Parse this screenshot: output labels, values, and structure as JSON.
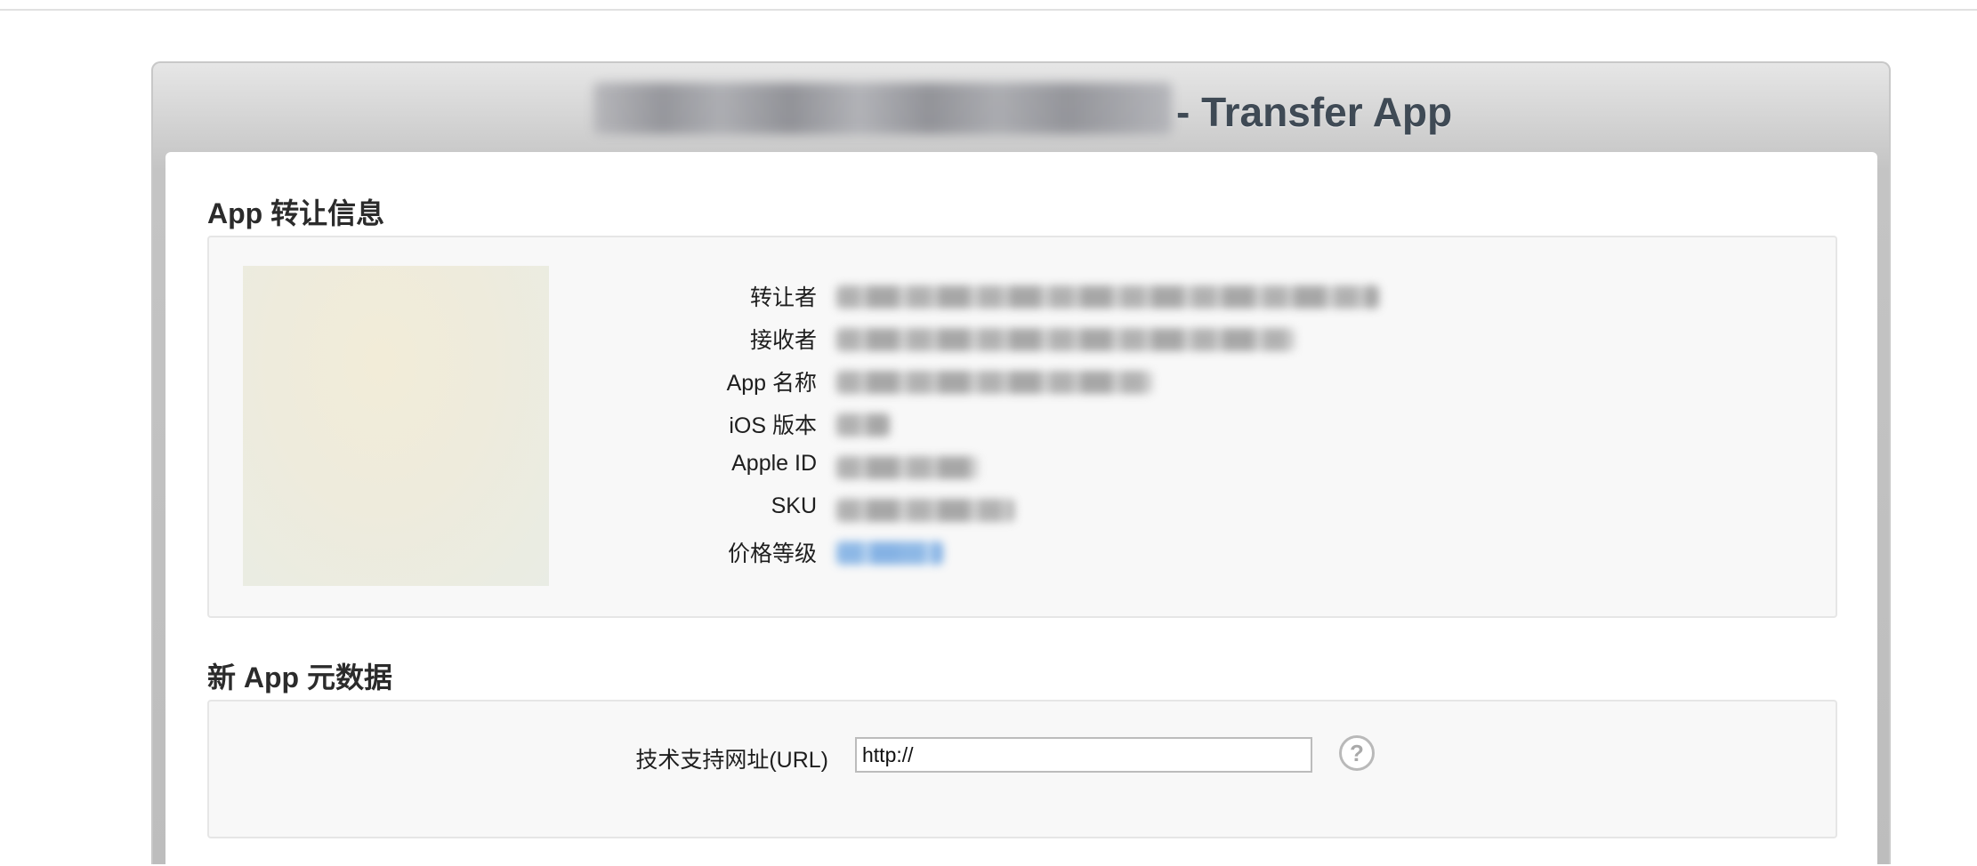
{
  "window": {
    "title_suffix": "- Transfer App"
  },
  "transfer_info": {
    "heading": "App 转让信息",
    "rows": [
      {
        "label": "转让者"
      },
      {
        "label": "接收者"
      },
      {
        "label": "App 名称"
      },
      {
        "label": "iOS 版本"
      },
      {
        "label": "Apple ID"
      },
      {
        "label": "SKU"
      },
      {
        "label": "价格等级"
      }
    ]
  },
  "metadata": {
    "heading": "新 App 元数据",
    "support_url_label": "技术支持网址(URL)",
    "support_url_value": "http://",
    "help_glyph": "?",
    "help_icon": "question-circle-icon"
  },
  "colors": {
    "title_text": "#3f4a55",
    "link_value": "#5f9bde",
    "panel_bg": "#f8f8f8"
  }
}
